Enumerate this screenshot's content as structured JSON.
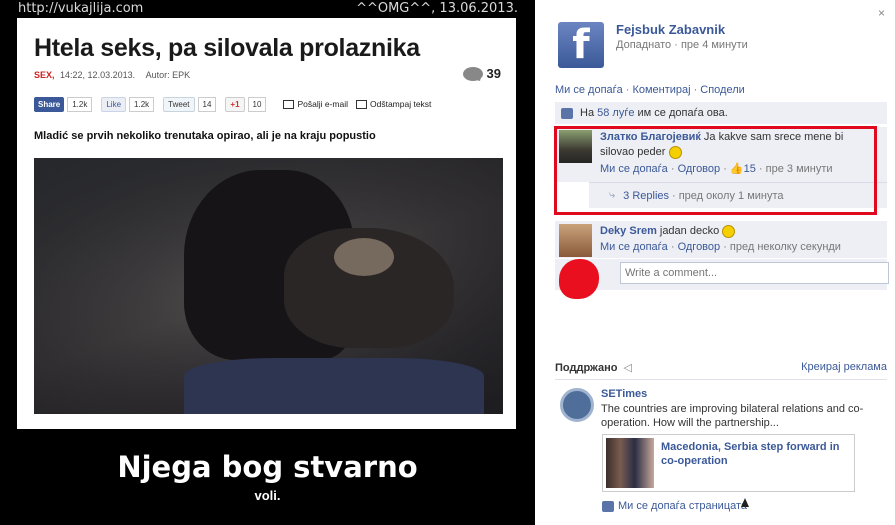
{
  "watermark": {
    "site": "http://vukajlija.com",
    "stamp": "^^OMG^^, 13.06.2013."
  },
  "article": {
    "title": "Htela seks, pa silovala prolaznika",
    "category": "SEX,",
    "datetime": "14:22, 12.03.2013.",
    "author": "Autor: EPK",
    "comment_count": "39",
    "share": {
      "fb_share": "Share",
      "fb_share_count": "1.2k",
      "fb_like": "Like",
      "fb_like_count": "1.2k",
      "tweet": "Tweet",
      "tweet_count": "14",
      "gplus": "+1",
      "gplus_count": "10",
      "email": "Pošalji e-mail",
      "print": "Odštampaj tekst"
    },
    "subtitle": "Mladić se prvih nekoliko trenutaka opirao, ali je na kraju popustio"
  },
  "caption": {
    "line1": "Njega bog stvarno",
    "line2": "voli."
  },
  "facebook": {
    "page_name": "Fejsbuk Zabavnik",
    "posted_time": "Допаднато · пре 4 минути",
    "logo_glyph": "f",
    "close": "×",
    "actions": [
      "Ми се допаѓа",
      "Коментирај",
      "Сподели"
    ],
    "likes_text_prefix": "На",
    "likes_link": "58 луѓе",
    "likes_text_suffix": "им се допаѓа ова.",
    "comments": [
      {
        "author": "Златко Благојевиќ",
        "text": "Ja kakve sam srece mene bi silovao peder",
        "like_action": "Ми се допаѓа",
        "reply_action": "Одговор",
        "like_count": "15",
        "time": "пре 3 минути",
        "replies_link": "3 Replies",
        "replies_time": "пред околу 1 минута"
      },
      {
        "author": "Deky Srem",
        "text": "jadan decko",
        "like_action": "Ми се допаѓа",
        "reply_action": "Одговор",
        "time": "пред неколку секунди"
      }
    ],
    "write_placeholder": "Write a comment..."
  },
  "sponsored": {
    "header": "Поддржано",
    "create_ad": "Креирај реклама",
    "advertiser": "SETimes",
    "text": "The countries are improving bilateral relations and co-operation. How will the partnership...",
    "card_title": "Macedonia, Serbia step forward in co-operation",
    "like_page": "Ми се допаѓа страницата"
  },
  "colors": {
    "fb_blue": "#3b5998",
    "highlight_red": "#e00a1e",
    "comment_bg": "#edeff4"
  }
}
